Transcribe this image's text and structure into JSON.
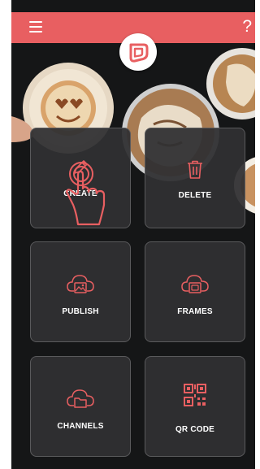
{
  "header": {
    "menu_icon": "hamburger-menu-icon",
    "help_label": "?",
    "logo_icon": "app-logo-icon",
    "accent_color": "#e85f61"
  },
  "tiles": [
    {
      "label": "CREATE",
      "icon": "pen-icon"
    },
    {
      "label": "DELETE",
      "icon": "trash-icon"
    },
    {
      "label": "PUBLISH",
      "icon": "cloud-image-icon"
    },
    {
      "label": "FRAMES",
      "icon": "cloud-frame-icon"
    },
    {
      "label": "CHANNELS",
      "icon": "cloud-folder-icon"
    },
    {
      "label": "QR CODE",
      "icon": "qr-code-icon"
    }
  ],
  "overlay": {
    "icon": "tap-gesture-hand-icon"
  }
}
